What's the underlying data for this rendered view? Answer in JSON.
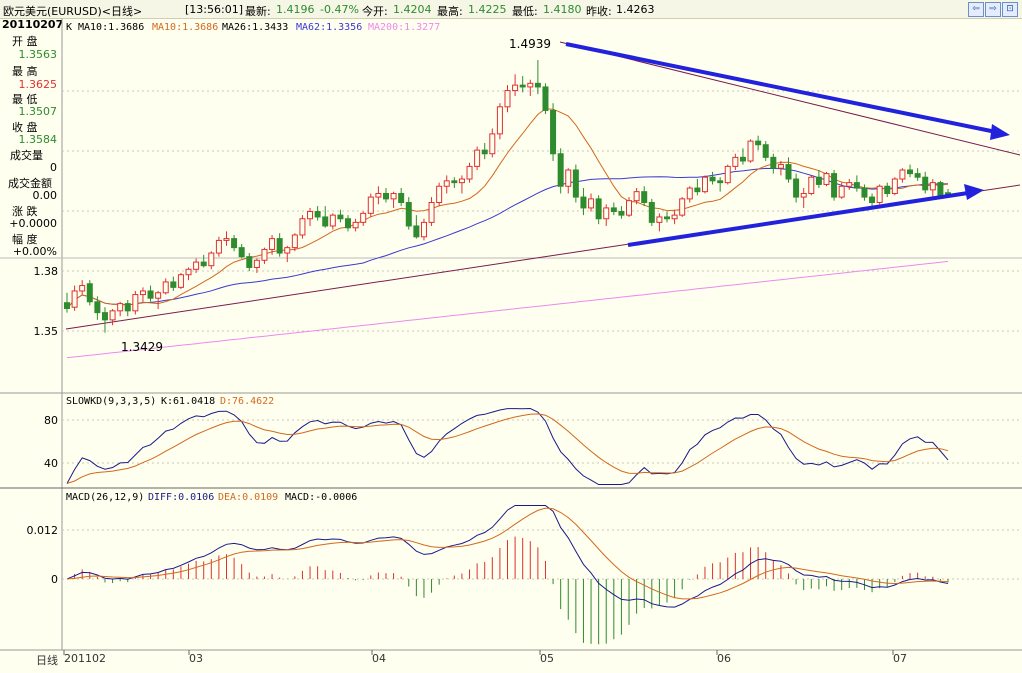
{
  "title_bar": {
    "instrument": "欧元美元(EURUSD)<日线>",
    "time": "[13:56:01]",
    "latest_label": "最新:",
    "latest_value": "1.4196",
    "change": "-0.47%",
    "open_label": "今开:",
    "open_value": "1.4204",
    "high_label": "最高:",
    "high_value": "1.4225",
    "low_label": "最低:",
    "low_value": "1.4180",
    "prev_close_label": "昨收:",
    "prev_close_value": "1.4263"
  },
  "info_panel": {
    "date": "20110207",
    "open_label": "开  盘",
    "open_value": "1.3563",
    "high_label": "最  高",
    "high_value": "1.3625",
    "low_label": "最  低",
    "low_value": "1.3507",
    "close_label": "收  盘",
    "close_value": "1.3584",
    "volume_label": "成交量",
    "volume_value": "0",
    "amount_label": "成交金额",
    "amount_value": "0.00",
    "change_label": "涨  跌",
    "change_value": "+0.0000",
    "range_label": "幅  度",
    "range_value": "+0.00%"
  },
  "main_header": {
    "k": "K",
    "ma10": "MA10:1.3686",
    "ma10b": "MA10:1.3686",
    "ma26": "MA26:1.3433",
    "ma62": "MA62:1.3356",
    "ma200": "MA200:1.3277"
  },
  "kd_header": {
    "name": "SLOWKD(9,3,3,5)",
    "k": "K:61.0418",
    "d": "D:76.4622"
  },
  "macd_header": {
    "name": "MACD(26,12,9)",
    "diff": "DIFF:0.0106",
    "dea": "DEA:0.0109",
    "macd": "MACD:-0.0006"
  },
  "footer": {
    "period": "日线",
    "dates": [
      "201102",
      "03",
      "04",
      "05",
      "06",
      "07"
    ]
  },
  "colors": {
    "up": "#e03030",
    "down": "#2e8b2e",
    "ma10": "#d2691e",
    "ma62": "#3a3ad0",
    "ma200": "#ee88ee",
    "trend": "#7a1b4c",
    "arrow": "#2222dd"
  },
  "chart_data": [
    {
      "type": "candlestick",
      "yticks": [
        "1.38",
        "1.35"
      ],
      "annotations": [
        "1.4939",
        "1.3429"
      ],
      "ylim": [
        1.325,
        1.505
      ],
      "candles": [
        {
          "o": 1.3595,
          "h": 1.365,
          "l": 1.354,
          "c": 1.3563
        },
        {
          "o": 1.357,
          "h": 1.369,
          "l": 1.355,
          "c": 1.366
        },
        {
          "o": 1.366,
          "h": 1.372,
          "l": 1.364,
          "c": 1.369
        },
        {
          "o": 1.37,
          "h": 1.372,
          "l": 1.358,
          "c": 1.36
        },
        {
          "o": 1.36,
          "h": 1.363,
          "l": 1.35,
          "c": 1.354
        },
        {
          "o": 1.354,
          "h": 1.357,
          "l": 1.3429,
          "c": 1.35
        },
        {
          "o": 1.35,
          "h": 1.356,
          "l": 1.347,
          "c": 1.355
        },
        {
          "o": 1.355,
          "h": 1.36,
          "l": 1.352,
          "c": 1.359
        },
        {
          "o": 1.359,
          "h": 1.361,
          "l": 1.352,
          "c": 1.355
        },
        {
          "o": 1.355,
          "h": 1.366,
          "l": 1.353,
          "c": 1.364
        },
        {
          "o": 1.364,
          "h": 1.368,
          "l": 1.36,
          "c": 1.366
        },
        {
          "o": 1.366,
          "h": 1.369,
          "l": 1.36,
          "c": 1.362
        },
        {
          "o": 1.362,
          "h": 1.366,
          "l": 1.356,
          "c": 1.365
        },
        {
          "o": 1.365,
          "h": 1.373,
          "l": 1.364,
          "c": 1.371
        },
        {
          "o": 1.371,
          "h": 1.374,
          "l": 1.366,
          "c": 1.368
        },
        {
          "o": 1.368,
          "h": 1.376,
          "l": 1.367,
          "c": 1.375
        },
        {
          "o": 1.375,
          "h": 1.379,
          "l": 1.372,
          "c": 1.378
        },
        {
          "o": 1.378,
          "h": 1.384,
          "l": 1.376,
          "c": 1.382
        },
        {
          "o": 1.382,
          "h": 1.386,
          "l": 1.379,
          "c": 1.38
        },
        {
          "o": 1.38,
          "h": 1.388,
          "l": 1.378,
          "c": 1.387
        },
        {
          "o": 1.387,
          "h": 1.396,
          "l": 1.385,
          "c": 1.394
        },
        {
          "o": 1.394,
          "h": 1.399,
          "l": 1.391,
          "c": 1.395
        },
        {
          "o": 1.395,
          "h": 1.397,
          "l": 1.388,
          "c": 1.39
        },
        {
          "o": 1.39,
          "h": 1.392,
          "l": 1.384,
          "c": 1.385
        },
        {
          "o": 1.385,
          "h": 1.387,
          "l": 1.377,
          "c": 1.379
        },
        {
          "o": 1.379,
          "h": 1.384,
          "l": 1.376,
          "c": 1.383
        },
        {
          "o": 1.383,
          "h": 1.39,
          "l": 1.381,
          "c": 1.389
        },
        {
          "o": 1.389,
          "h": 1.397,
          "l": 1.386,
          "c": 1.395
        },
        {
          "o": 1.395,
          "h": 1.398,
          "l": 1.385,
          "c": 1.387
        },
        {
          "o": 1.387,
          "h": 1.391,
          "l": 1.382,
          "c": 1.39
        },
        {
          "o": 1.39,
          "h": 1.398,
          "l": 1.388,
          "c": 1.397
        },
        {
          "o": 1.397,
          "h": 1.408,
          "l": 1.395,
          "c": 1.406
        },
        {
          "o": 1.406,
          "h": 1.412,
          "l": 1.402,
          "c": 1.41
        },
        {
          "o": 1.41,
          "h": 1.413,
          "l": 1.405,
          "c": 1.407
        },
        {
          "o": 1.407,
          "h": 1.413,
          "l": 1.401,
          "c": 1.402
        },
        {
          "o": 1.402,
          "h": 1.409,
          "l": 1.4,
          "c": 1.408
        },
        {
          "o": 1.408,
          "h": 1.411,
          "l": 1.404,
          "c": 1.406
        },
        {
          "o": 1.406,
          "h": 1.408,
          "l": 1.399,
          "c": 1.401
        },
        {
          "o": 1.401,
          "h": 1.406,
          "l": 1.399,
          "c": 1.404
        },
        {
          "o": 1.404,
          "h": 1.41,
          "l": 1.402,
          "c": 1.409
        },
        {
          "o": 1.409,
          "h": 1.42,
          "l": 1.407,
          "c": 1.418
        },
        {
          "o": 1.418,
          "h": 1.424,
          "l": 1.414,
          "c": 1.42
        },
        {
          "o": 1.42,
          "h": 1.423,
          "l": 1.415,
          "c": 1.417
        },
        {
          "o": 1.417,
          "h": 1.421,
          "l": 1.412,
          "c": 1.42
        },
        {
          "o": 1.42,
          "h": 1.423,
          "l": 1.413,
          "c": 1.415
        },
        {
          "o": 1.415,
          "h": 1.418,
          "l": 1.4,
          "c": 1.402
        },
        {
          "o": 1.402,
          "h": 1.408,
          "l": 1.395,
          "c": 1.396
        },
        {
          "o": 1.396,
          "h": 1.406,
          "l": 1.394,
          "c": 1.404
        },
        {
          "o": 1.404,
          "h": 1.418,
          "l": 1.402,
          "c": 1.415
        },
        {
          "o": 1.415,
          "h": 1.426,
          "l": 1.413,
          "c": 1.424
        },
        {
          "o": 1.424,
          "h": 1.43,
          "l": 1.42,
          "c": 1.427
        },
        {
          "o": 1.427,
          "h": 1.429,
          "l": 1.423,
          "c": 1.426
        },
        {
          "o": 1.426,
          "h": 1.43,
          "l": 1.42,
          "c": 1.428
        },
        {
          "o": 1.428,
          "h": 1.437,
          "l": 1.426,
          "c": 1.435
        },
        {
          "o": 1.435,
          "h": 1.446,
          "l": 1.433,
          "c": 1.444
        },
        {
          "o": 1.444,
          "h": 1.448,
          "l": 1.439,
          "c": 1.442
        },
        {
          "o": 1.442,
          "h": 1.456,
          "l": 1.44,
          "c": 1.453
        },
        {
          "o": 1.453,
          "h": 1.47,
          "l": 1.45,
          "c": 1.468
        },
        {
          "o": 1.468,
          "h": 1.48,
          "l": 1.465,
          "c": 1.477
        },
        {
          "o": 1.477,
          "h": 1.486,
          "l": 1.474,
          "c": 1.48
        },
        {
          "o": 1.48,
          "h": 1.485,
          "l": 1.476,
          "c": 1.479
        },
        {
          "o": 1.479,
          "h": 1.483,
          "l": 1.474,
          "c": 1.481
        },
        {
          "o": 1.481,
          "h": 1.4939,
          "l": 1.475,
          "c": 1.479
        },
        {
          "o": 1.479,
          "h": 1.481,
          "l": 1.464,
          "c": 1.466
        },
        {
          "o": 1.466,
          "h": 1.47,
          "l": 1.438,
          "c": 1.442
        },
        {
          "o": 1.442,
          "h": 1.445,
          "l": 1.42,
          "c": 1.424
        },
        {
          "o": 1.424,
          "h": 1.434,
          "l": 1.42,
          "c": 1.433
        },
        {
          "o": 1.433,
          "h": 1.436,
          "l": 1.415,
          "c": 1.418
        },
        {
          "o": 1.418,
          "h": 1.423,
          "l": 1.408,
          "c": 1.412
        },
        {
          "o": 1.412,
          "h": 1.42,
          "l": 1.41,
          "c": 1.417
        },
        {
          "o": 1.417,
          "h": 1.419,
          "l": 1.403,
          "c": 1.406
        },
        {
          "o": 1.406,
          "h": 1.414,
          "l": 1.402,
          "c": 1.412
        },
        {
          "o": 1.412,
          "h": 1.415,
          "l": 1.408,
          "c": 1.41
        },
        {
          "o": 1.41,
          "h": 1.413,
          "l": 1.406,
          "c": 1.408
        },
        {
          "o": 1.408,
          "h": 1.418,
          "l": 1.407,
          "c": 1.416
        },
        {
          "o": 1.416,
          "h": 1.423,
          "l": 1.414,
          "c": 1.421
        },
        {
          "o": 1.421,
          "h": 1.424,
          "l": 1.413,
          "c": 1.415
        },
        {
          "o": 1.415,
          "h": 1.417,
          "l": 1.402,
          "c": 1.404
        },
        {
          "o": 1.404,
          "h": 1.409,
          "l": 1.399,
          "c": 1.407
        },
        {
          "o": 1.407,
          "h": 1.41,
          "l": 1.404,
          "c": 1.406
        },
        {
          "o": 1.406,
          "h": 1.411,
          "l": 1.403,
          "c": 1.408
        },
        {
          "o": 1.408,
          "h": 1.418,
          "l": 1.407,
          "c": 1.417
        },
        {
          "o": 1.417,
          "h": 1.424,
          "l": 1.415,
          "c": 1.423
        },
        {
          "o": 1.423,
          "h": 1.428,
          "l": 1.419,
          "c": 1.421
        },
        {
          "o": 1.421,
          "h": 1.43,
          "l": 1.42,
          "c": 1.429
        },
        {
          "o": 1.429,
          "h": 1.432,
          "l": 1.425,
          "c": 1.427
        },
        {
          "o": 1.427,
          "h": 1.429,
          "l": 1.421,
          "c": 1.426
        },
        {
          "o": 1.426,
          "h": 1.436,
          "l": 1.425,
          "c": 1.435
        },
        {
          "o": 1.435,
          "h": 1.442,
          "l": 1.433,
          "c": 1.44
        },
        {
          "o": 1.44,
          "h": 1.445,
          "l": 1.436,
          "c": 1.438
        },
        {
          "o": 1.438,
          "h": 1.45,
          "l": 1.437,
          "c": 1.449
        },
        {
          "o": 1.449,
          "h": 1.452,
          "l": 1.444,
          "c": 1.447
        },
        {
          "o": 1.447,
          "h": 1.449,
          "l": 1.438,
          "c": 1.44
        },
        {
          "o": 1.44,
          "h": 1.442,
          "l": 1.431,
          "c": 1.434
        },
        {
          "o": 1.434,
          "h": 1.438,
          "l": 1.43,
          "c": 1.436
        },
        {
          "o": 1.436,
          "h": 1.44,
          "l": 1.426,
          "c": 1.428
        },
        {
          "o": 1.428,
          "h": 1.431,
          "l": 1.415,
          "c": 1.418
        },
        {
          "o": 1.418,
          "h": 1.423,
          "l": 1.412,
          "c": 1.42
        },
        {
          "o": 1.42,
          "h": 1.43,
          "l": 1.419,
          "c": 1.429
        },
        {
          "o": 1.429,
          "h": 1.433,
          "l": 1.423,
          "c": 1.425
        },
        {
          "o": 1.425,
          "h": 1.432,
          "l": 1.424,
          "c": 1.431
        },
        {
          "o": 1.431,
          "h": 1.433,
          "l": 1.416,
          "c": 1.418
        },
        {
          "o": 1.418,
          "h": 1.426,
          "l": 1.417,
          "c": 1.424
        },
        {
          "o": 1.424,
          "h": 1.428,
          "l": 1.422,
          "c": 1.426
        },
        {
          "o": 1.426,
          "h": 1.43,
          "l": 1.421,
          "c": 1.423
        },
        {
          "o": 1.423,
          "h": 1.425,
          "l": 1.416,
          "c": 1.418
        },
        {
          "o": 1.418,
          "h": 1.42,
          "l": 1.412,
          "c": 1.415
        },
        {
          "o": 1.415,
          "h": 1.425,
          "l": 1.414,
          "c": 1.424
        },
        {
          "o": 1.424,
          "h": 1.426,
          "l": 1.418,
          "c": 1.42
        },
        {
          "o": 1.42,
          "h": 1.429,
          "l": 1.419,
          "c": 1.428
        },
        {
          "o": 1.428,
          "h": 1.434,
          "l": 1.426,
          "c": 1.433
        },
        {
          "o": 1.433,
          "h": 1.436,
          "l": 1.429,
          "c": 1.431
        },
        {
          "o": 1.431,
          "h": 1.434,
          "l": 1.427,
          "c": 1.429
        },
        {
          "o": 1.429,
          "h": 1.432,
          "l": 1.42,
          "c": 1.422
        },
        {
          "o": 1.422,
          "h": 1.428,
          "l": 1.418,
          "c": 1.426
        },
        {
          "o": 1.426,
          "h": 1.427,
          "l": 1.417,
          "c": 1.419
        },
        {
          "o": 1.4204,
          "h": 1.4225,
          "l": 1.418,
          "c": 1.4196
        }
      ]
    },
    {
      "type": "line",
      "name": "SLOWKD",
      "yticks": [
        "80",
        "40"
      ],
      "ylim": [
        20,
        100
      ]
    },
    {
      "type": "bar",
      "name": "MACD",
      "yticks": [
        "0.012",
        "0"
      ],
      "ylim": [
        -0.015,
        0.02
      ]
    }
  ]
}
